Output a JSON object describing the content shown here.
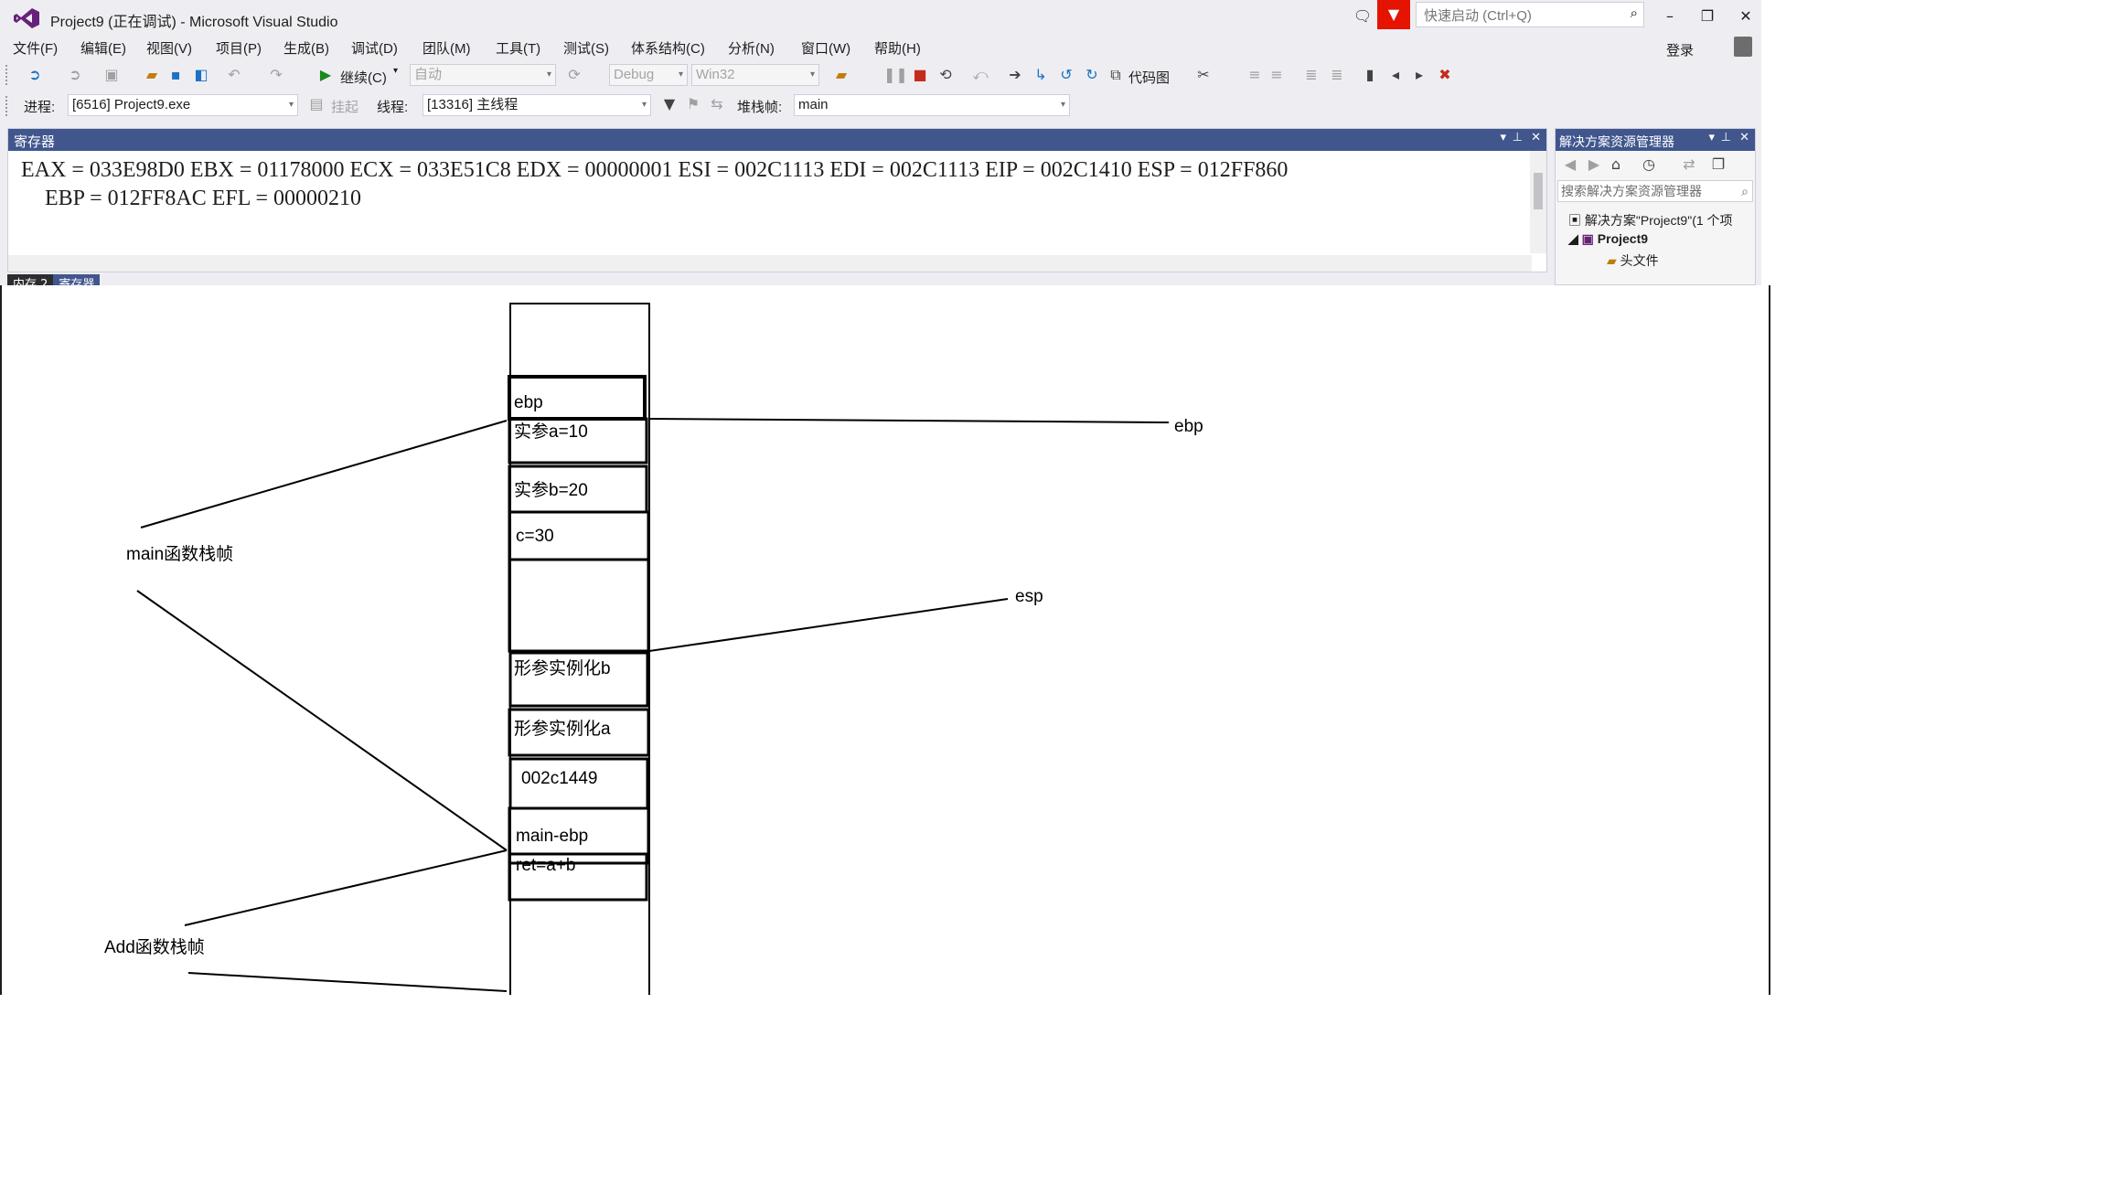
{
  "window": {
    "title": "Project9 (正在调试) - Microsoft Visual Studio",
    "quick_launch_placeholder": "快速启动 (Ctrl+Q)",
    "login": "登录"
  },
  "menu": [
    "文件(F)",
    "编辑(E)",
    "视图(V)",
    "项目(P)",
    "生成(B)",
    "调试(D)",
    "团队(M)",
    "工具(T)",
    "测试(S)",
    "体系结构(C)",
    "分析(N)",
    "窗口(W)",
    "帮助(H)"
  ],
  "toolbar": {
    "continue_label": "继续(C)",
    "solution_config": "自动",
    "build_config": "Debug",
    "platform": "Win32",
    "code_map_label": "代码图",
    "process_label": "进程:",
    "process_value": "[6516] Project9.exe",
    "suspend_label": "挂起",
    "thread_label": "线程:",
    "thread_value": "[13316] 主线程",
    "stack_frame_label": "堆栈帧:",
    "stack_frame_value": "main"
  },
  "registers": {
    "title": "寄存器",
    "line1": "EAX = 033E98D0 EBX = 01178000 ECX = 033E51C8 EDX = 00000001 ESI = 002C1113 EDI = 002C1113 EIP = 002C1410 ESP = 012FF860",
    "line2": "EBP = 012FF8AC EFL = 00000210",
    "tabs": [
      "内存 2",
      "寄存器"
    ]
  },
  "solution_explorer": {
    "title": "解决方案资源管理器",
    "search_placeholder": "搜索解决方案资源管理器",
    "solution_item": "解决方案\"Project9\"(1 个项",
    "project_item": "Project9",
    "folder_item": "头文件"
  },
  "diagram": {
    "stack_cells": [
      "ebp",
      "实参a=10",
      "实参b=20",
      "c=30",
      "形参实例化b",
      "形参实例化a",
      "002c1449",
      "main-ebp",
      "ret=a+b"
    ],
    "main_frame_label": "main函数栈帧",
    "add_frame_label": "Add函数栈帧",
    "ebp_label": "ebp",
    "esp_label": "esp"
  }
}
